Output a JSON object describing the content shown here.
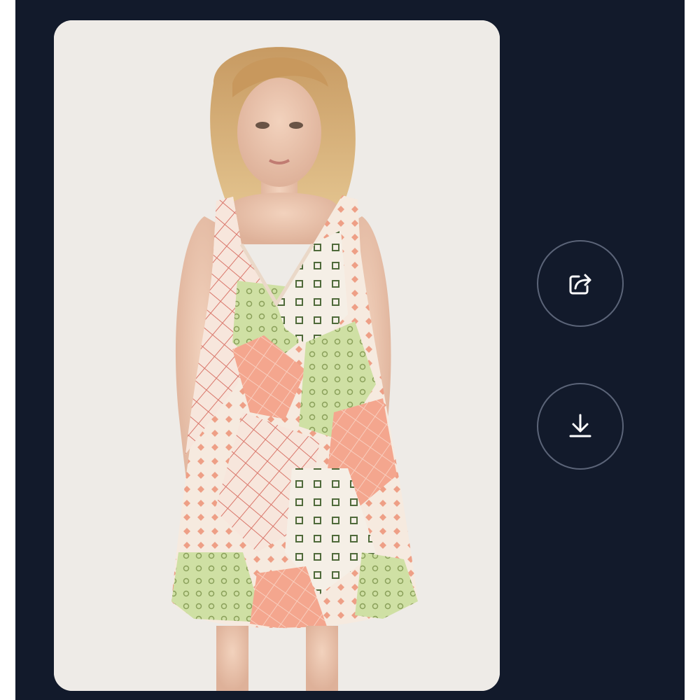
{
  "colors": {
    "screen_background": "#121a2b",
    "button_border": "#5b6478",
    "icon_color": "#ffffff"
  },
  "product_image": {
    "subject": "model-in-patchwork-print-sleeveless-mini-dress",
    "palette": [
      "#f3a088",
      "#c8dc9a",
      "#f6eee6",
      "#d96c5c"
    ]
  },
  "actions": [
    {
      "id": "share",
      "icon": "share-icon"
    },
    {
      "id": "download",
      "icon": "download-icon"
    }
  ]
}
